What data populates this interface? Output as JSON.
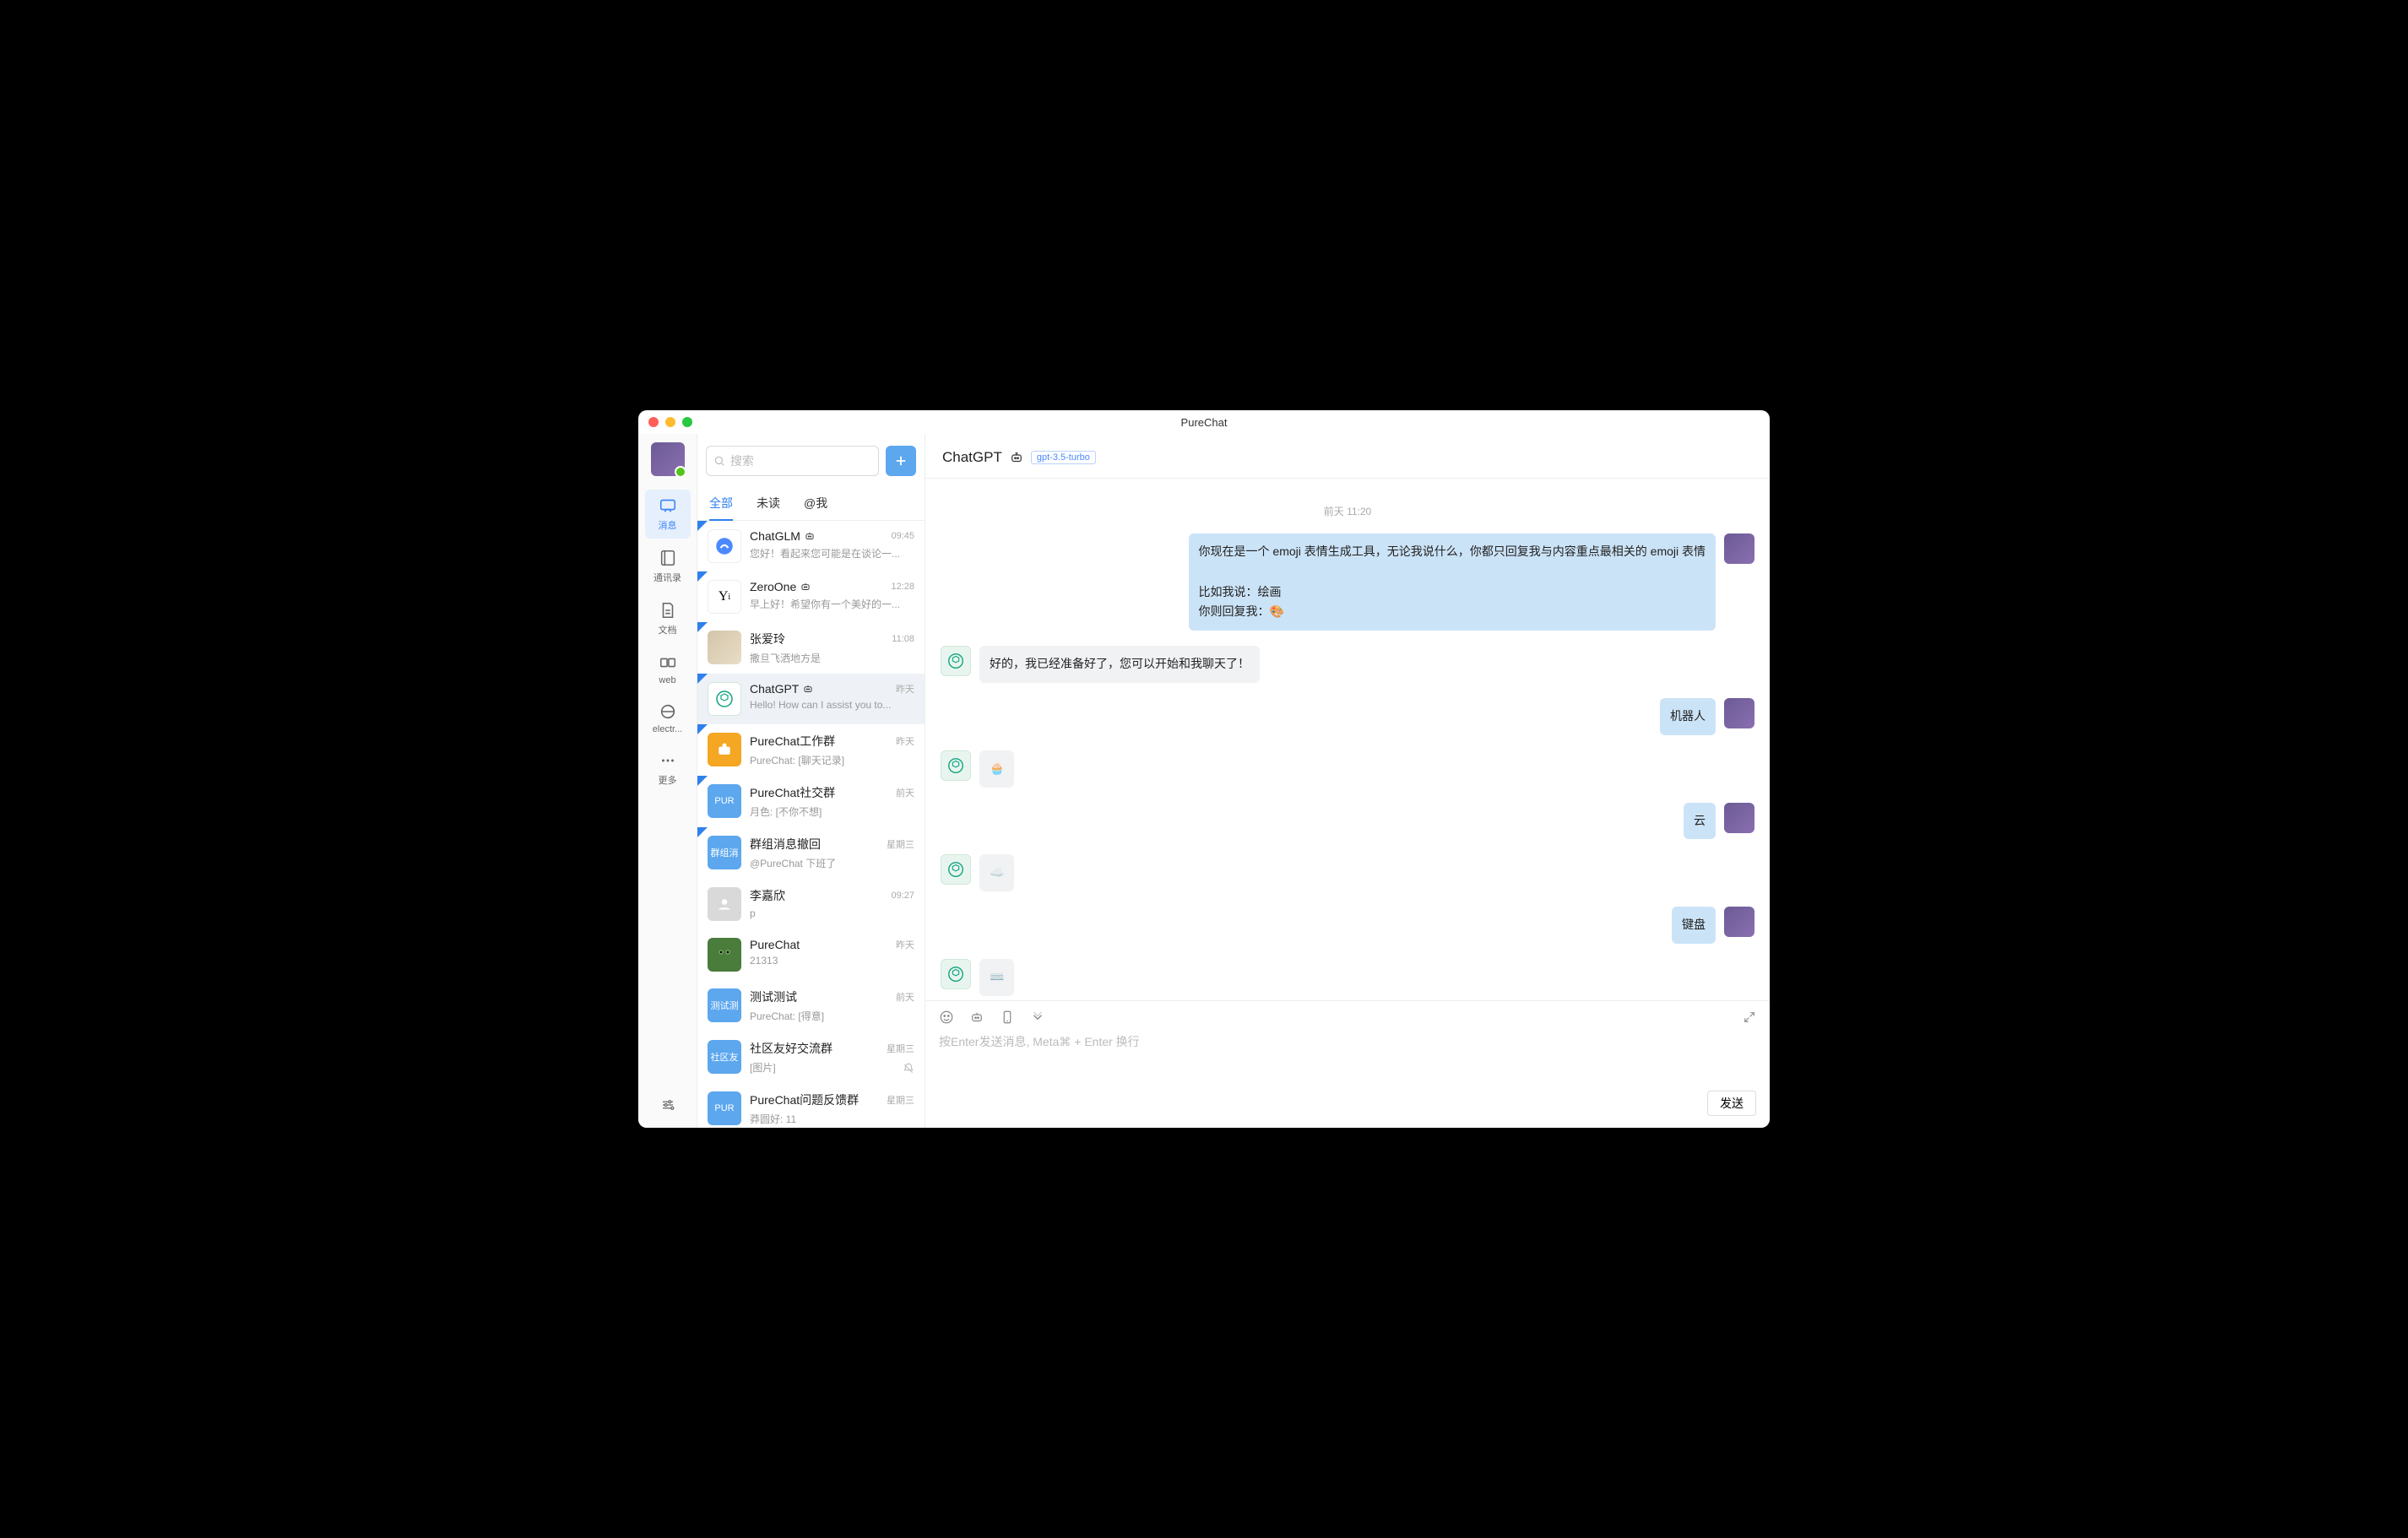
{
  "window": {
    "title": "PureChat"
  },
  "rail": {
    "items": [
      {
        "key": "messages",
        "label": "消息",
        "active": true
      },
      {
        "key": "contacts",
        "label": "通讯录",
        "active": false
      },
      {
        "key": "docs",
        "label": "文档",
        "active": false
      },
      {
        "key": "web",
        "label": "web",
        "active": false
      },
      {
        "key": "electron",
        "label": "electr...",
        "active": false
      },
      {
        "key": "more",
        "label": "更多",
        "active": false
      }
    ]
  },
  "search": {
    "placeholder": "搜索"
  },
  "filters": [
    "全部",
    "未读",
    "@我"
  ],
  "conversations": [
    {
      "name": "ChatGLM",
      "robot": true,
      "preview": "您好！看起来您可能是在谈论一...",
      "time": "09:45",
      "flagged": true,
      "avatar": {
        "type": "glm"
      }
    },
    {
      "name": "ZeroOne",
      "robot": true,
      "preview": "早上好！希望你有一个美好的一...",
      "time": "12:28",
      "flagged": true,
      "avatar": {
        "type": "zeroone"
      }
    },
    {
      "name": "张爱玲",
      "robot": false,
      "preview": "撒旦飞洒地方是",
      "time": "11:08",
      "flagged": true,
      "avatar": {
        "type": "photo"
      }
    },
    {
      "name": "ChatGPT",
      "robot": true,
      "preview": "Hello! How can I assist you to...",
      "time": "昨天",
      "flagged": true,
      "selected": true,
      "avatar": {
        "type": "gpt"
      }
    },
    {
      "name": "PureChat工作群",
      "robot": false,
      "preview": "PureChat: [聊天记录]",
      "time": "昨天",
      "flagged": true,
      "avatar": {
        "type": "work",
        "bg": "#f5a623"
      }
    },
    {
      "name": "PureChat社交群",
      "robot": false,
      "preview": "月色: [不你不想]",
      "time": "前天",
      "flagged": true,
      "avatar": {
        "type": "text",
        "text": "PUR",
        "bg": "#5ca7ee"
      }
    },
    {
      "name": "群组消息撤回",
      "robot": false,
      "preview": "@PureChat 下班了",
      "time": "星期三",
      "flagged": true,
      "avatar": {
        "type": "text",
        "text": "群组消",
        "bg": "#5ca7ee"
      }
    },
    {
      "name": "李嘉欣",
      "robot": false,
      "preview": "p",
      "time": "09:27",
      "flagged": false,
      "avatar": {
        "type": "placeholder"
      }
    },
    {
      "name": "PureChat",
      "robot": false,
      "preview": "21313",
      "time": "昨天",
      "flagged": false,
      "avatar": {
        "type": "frog"
      }
    },
    {
      "name": "测试测试",
      "robot": false,
      "preview": "PureChat: [得意]",
      "time": "前天",
      "flagged": false,
      "avatar": {
        "type": "text",
        "text": "测试测",
        "bg": "#5ca7ee"
      }
    },
    {
      "name": "社区友好交流群",
      "robot": false,
      "preview": "[图片]",
      "time": "星期三",
      "flagged": false,
      "muted": true,
      "avatar": {
        "type": "text",
        "text": "社区友",
        "bg": "#5ca7ee"
      }
    },
    {
      "name": "PureChat问题反馈群",
      "robot": false,
      "preview": "莽圆好: 11",
      "time": "星期三",
      "flagged": false,
      "avatar": {
        "type": "text",
        "text": "PUR",
        "bg": "#5ca7ee"
      }
    }
  ],
  "chat": {
    "name": "ChatGPT",
    "model": "gpt-3.5-turbo",
    "timestamp": "前天 11:20",
    "messages": [
      {
        "from": "me",
        "text": "你现在是一个 emoji 表情生成工具，无论我说什么，你都只回复我与内容重点最相关的 emoji 表情\n\n比如我说：绘画\n你则回复我：🎨"
      },
      {
        "from": "bot",
        "text": "好的，我已经准备好了，您可以开始和我聊天了！"
      },
      {
        "from": "me",
        "text": "机器人"
      },
      {
        "from": "bot",
        "text": "🧁"
      },
      {
        "from": "me",
        "text": "云"
      },
      {
        "from": "bot",
        "text": "☁️"
      },
      {
        "from": "me",
        "text": "键盘"
      },
      {
        "from": "bot",
        "text": "⌨️"
      }
    ]
  },
  "input": {
    "placeholder": "按Enter发送消息, Meta⌘ + Enter 换行",
    "send_label": "发送"
  }
}
